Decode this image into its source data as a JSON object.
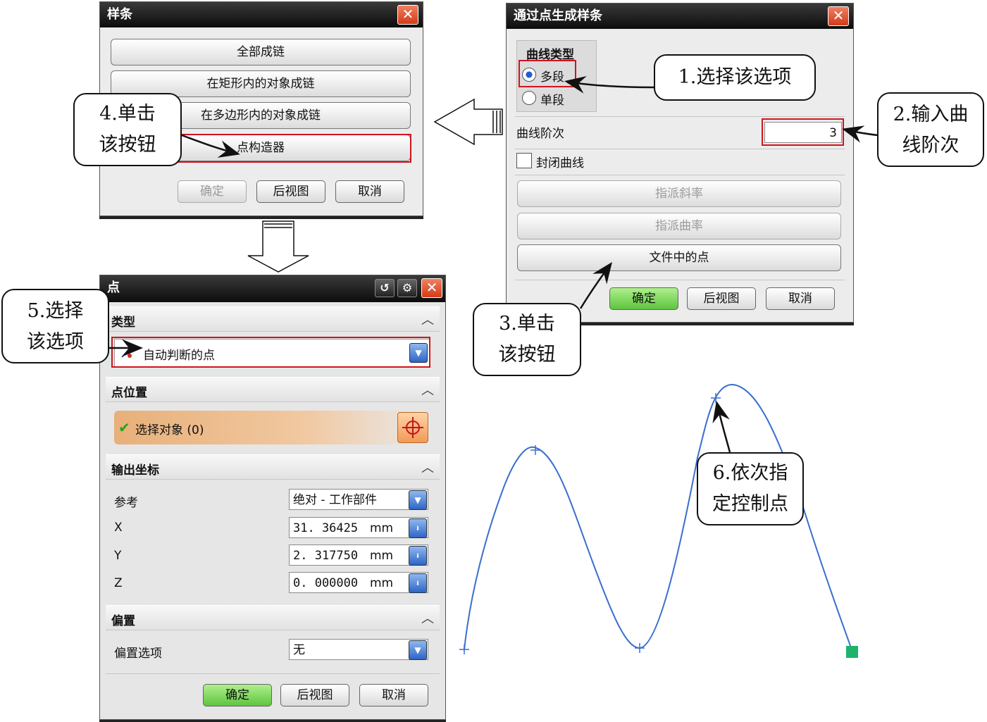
{
  "spline_dialog": {
    "title": "样条",
    "close": "✕",
    "buttons": [
      "全部成链",
      "在矩形内的对象成链",
      "在多边形内的对象成链",
      "点构造器"
    ],
    "ok": "确定",
    "back": "后视图",
    "cancel": "取消"
  },
  "through_points_dialog": {
    "title": "通过点生成样条",
    "close": "✕",
    "curve_type_label": "曲线类型",
    "option_multi": "多段",
    "option_single": "单段",
    "degree_label": "曲线阶次",
    "degree_value": "3",
    "closed_curve_label": "封闭曲线",
    "assign_slope": "指派斜率",
    "assign_curvature": "指派曲率",
    "points_from_file": "文件中的点",
    "ok": "确定",
    "back": "后视图",
    "cancel": "取消"
  },
  "point_dialog": {
    "title": "点",
    "reset_icon": "↺",
    "gear_icon": "⚙",
    "close": "✕",
    "type_section": "类型",
    "type_value": "自动判断的点",
    "location_section": "点位置",
    "select_object": "选择对象 (0)",
    "output_section": "输出坐标",
    "reference_label": "参考",
    "reference_value": "绝对 - 工作部件",
    "x_label": "X",
    "x_value": "31. 36425",
    "y_label": "Y",
    "y_value": "2. 317750",
    "z_label": "Z",
    "z_value": "0. 000000",
    "unit": "mm",
    "offset_section": "偏置",
    "offset_option_label": "偏置选项",
    "offset_option_value": "无",
    "ok": "确定",
    "back": "后视图",
    "cancel": "取消"
  },
  "callouts": {
    "c1": "1.选择该选项",
    "c2_line1": "2.输入曲",
    "c2_line2": "线阶次",
    "c3_line1": "3.单击",
    "c3_line2": "该按钮",
    "c4_line1": "4.单击",
    "c4_line2": "该按钮",
    "c5_line1": "5.选择",
    "c5_line2": "该选项",
    "c6_line1": "6.依次指",
    "c6_line2": "定控制点"
  },
  "colors": {
    "highlight_red": "#d0141e",
    "curve_blue": "#3a6fcf",
    "ok_green": "#5ec43f",
    "endpoint_green": "#1db36b"
  }
}
